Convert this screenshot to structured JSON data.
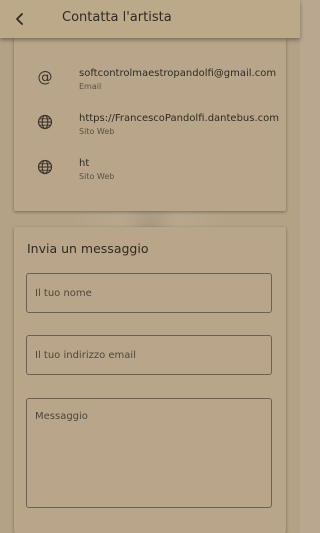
{
  "header": {
    "title": "Contatta l'artista",
    "back_icon": "arrow-left-icon"
  },
  "contacts": [
    {
      "icon": "at-icon",
      "value": "softcontrolmaestropandolfi@gmail.com",
      "label": "Email"
    },
    {
      "icon": "globe-icon",
      "value": "https://FrancescoPandolfi.dantebus.com",
      "label": "Sito Web"
    },
    {
      "icon": "globe-icon",
      "value": "ht",
      "label": "Sito Web"
    }
  ],
  "message_form": {
    "title": "Invia un messaggio",
    "name_placeholder": "Il tuo nome",
    "email_placeholder": "Il tuo indirizzo email",
    "message_placeholder": "Messaggio"
  },
  "colors": {
    "background": "#b4a287",
    "card": "#b9a68a",
    "text": "#2f2a24",
    "border": "#6d6153"
  }
}
